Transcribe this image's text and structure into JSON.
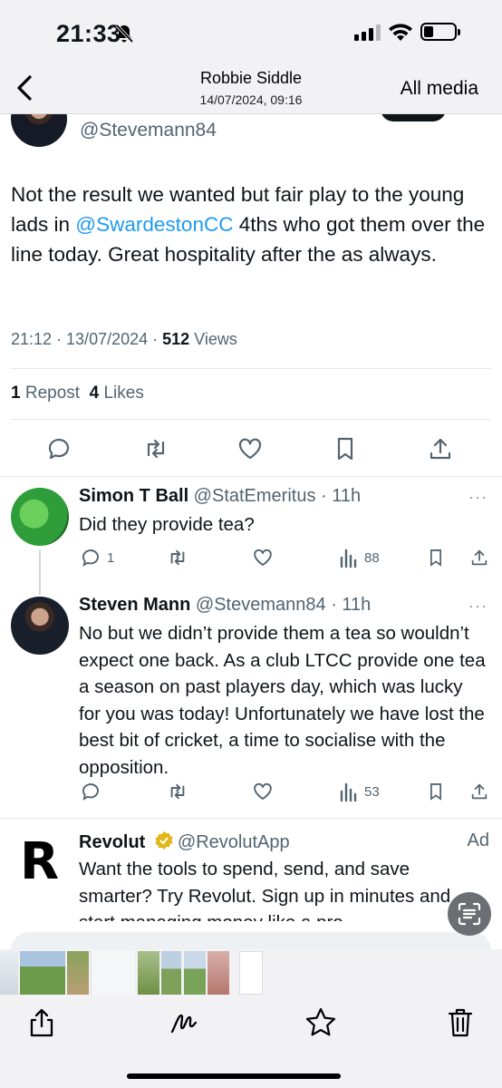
{
  "status_bar": {
    "time": "21:33",
    "icons": [
      "bell-slash-icon",
      "cellular-signal-icon",
      "wifi-icon",
      "battery-icon"
    ]
  },
  "nav": {
    "title": "Robbie Siddle",
    "subtitle": "14/07/2024, 09:16",
    "all_media_label": "All media"
  },
  "main_tweet": {
    "handle": "@Stevemann84",
    "text_before": "Not the result we wanted but fair play to the young lads in ",
    "mention": "@SwardestonCC",
    "text_after": " 4ths who got them over the line today. Great hospitality after the as always.",
    "timestamp": "21:12 · 13/07/2024 · ",
    "views_count": "512",
    "views_label": " Views",
    "reposts_count": "1",
    "reposts_label": " Repost",
    "likes_count": "4",
    "likes_label": " Likes"
  },
  "replies": [
    {
      "name": "Simon T Ball",
      "handle": " @StatEmeritus · 11h",
      "text": "Did they provide tea?",
      "reply_count": "1",
      "views": "88"
    },
    {
      "name": "Steven Mann",
      "handle": " @Stevemann84 · 11h",
      "text": "No but we didn’t provide them a tea so wouldn’t expect one back. As a club LTCC provide one tea a season on past players day, which was lucky for you was today! Unfortunately we have lost the best bit of cricket, a time to socialise with the opposition.",
      "reply_count": "",
      "views": "53"
    }
  ],
  "ad": {
    "name": "Revolut",
    "handle": "@RevolutApp",
    "badge": "Ad",
    "logo_letter": "R",
    "text": "Want the tools to spend, send, and save smarter? Try Revolut. Sign up in minutes and start managing money like a pro."
  },
  "more_glyph": "···",
  "colors": {
    "link": "#1d9bf0",
    "text": "#0f1419",
    "muted": "#536471",
    "verified": "#e2b719"
  }
}
